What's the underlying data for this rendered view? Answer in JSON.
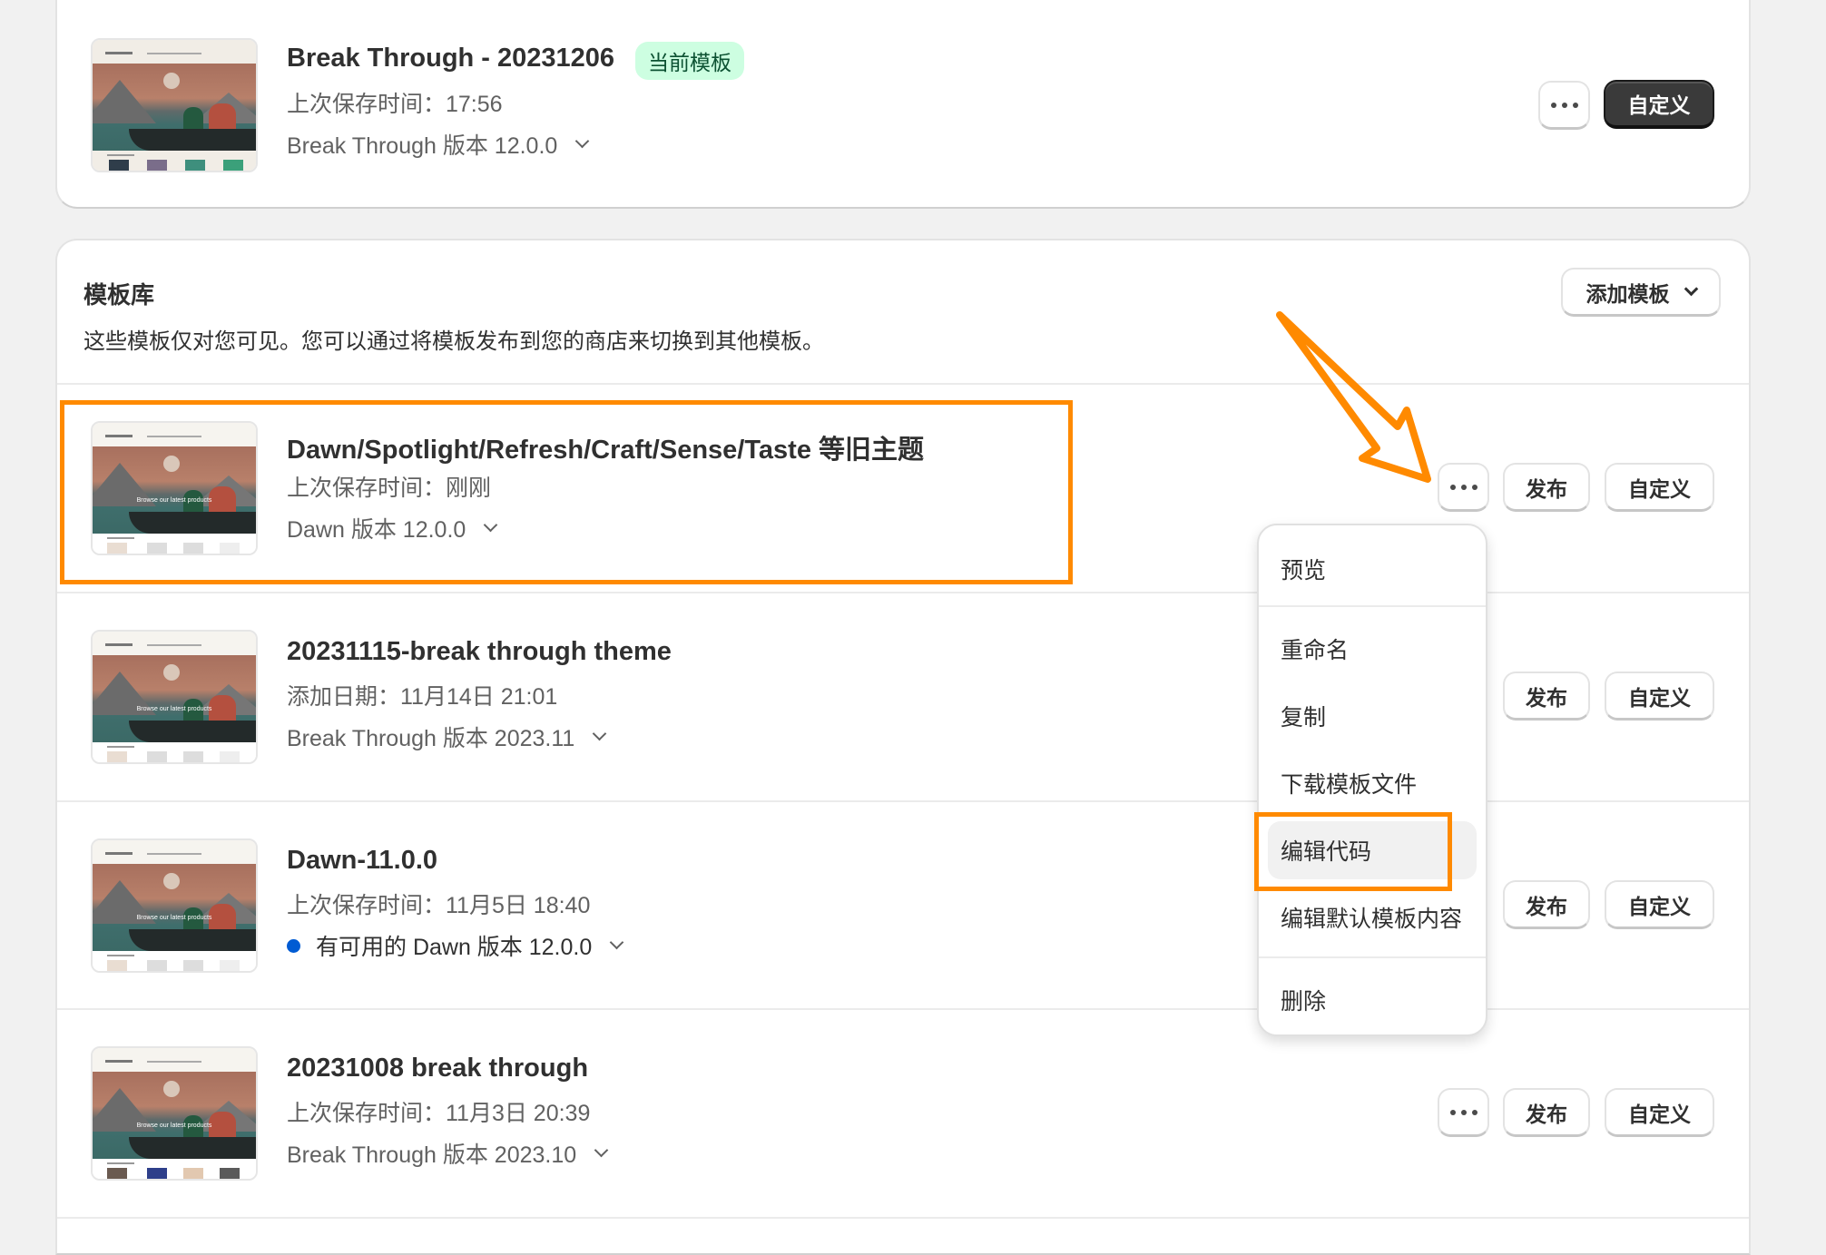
{
  "current_theme": {
    "name": "Break Through - 20231206",
    "badge": "当前模板",
    "saved": "上次保存时间：17:56",
    "version": "Break Through 版本 12.0.0",
    "more_label": "更多操作",
    "customize_label": "自定义"
  },
  "library": {
    "title": "模板库",
    "description": "这些模板仅对您可见。您可以通过将模板发布到您的商店来切换到其他模板。",
    "add_button": "添加模板",
    "thumbnail_tagline": "Browse our latest products",
    "themes": [
      {
        "name": "Dawn/Spotlight/Refresh/Craft/Sense/Taste 等旧主题",
        "meta": "上次保存时间：刚刚",
        "version": "Dawn 版本 12.0.0",
        "update_available": false,
        "highlighted": true
      },
      {
        "name": "20231115-break through theme",
        "meta": "添加日期：11月14日 21:01",
        "version": "Break Through 版本 2023.11",
        "update_available": false,
        "highlighted": false
      },
      {
        "name": "Dawn-11.0.0",
        "meta": "上次保存时间：11月5日 18:40",
        "version": "有可用的 Dawn 版本 12.0.0",
        "update_available": true,
        "highlighted": false
      },
      {
        "name": "20231008 break through",
        "meta": "上次保存时间：11月3日 20:39",
        "version": "Break Through 版本 2023.10",
        "update_available": false,
        "highlighted": false
      }
    ],
    "publish_label": "发布",
    "customize_label": "自定义"
  },
  "actions_menu": {
    "items": [
      {
        "label": "预览"
      },
      {
        "label": "重命名"
      },
      {
        "label": "复制"
      },
      {
        "label": "下载模板文件"
      },
      {
        "label": "编辑代码",
        "active": true
      },
      {
        "label": "编辑默认模板内容"
      },
      {
        "label": "删除"
      }
    ]
  },
  "colors": {
    "annotation": "#ff8a00",
    "badge_bg": "#cdfee1",
    "badge_text": "#0c5132",
    "update_dot": "#005bd3",
    "primary_button": "#3a3a3a"
  }
}
